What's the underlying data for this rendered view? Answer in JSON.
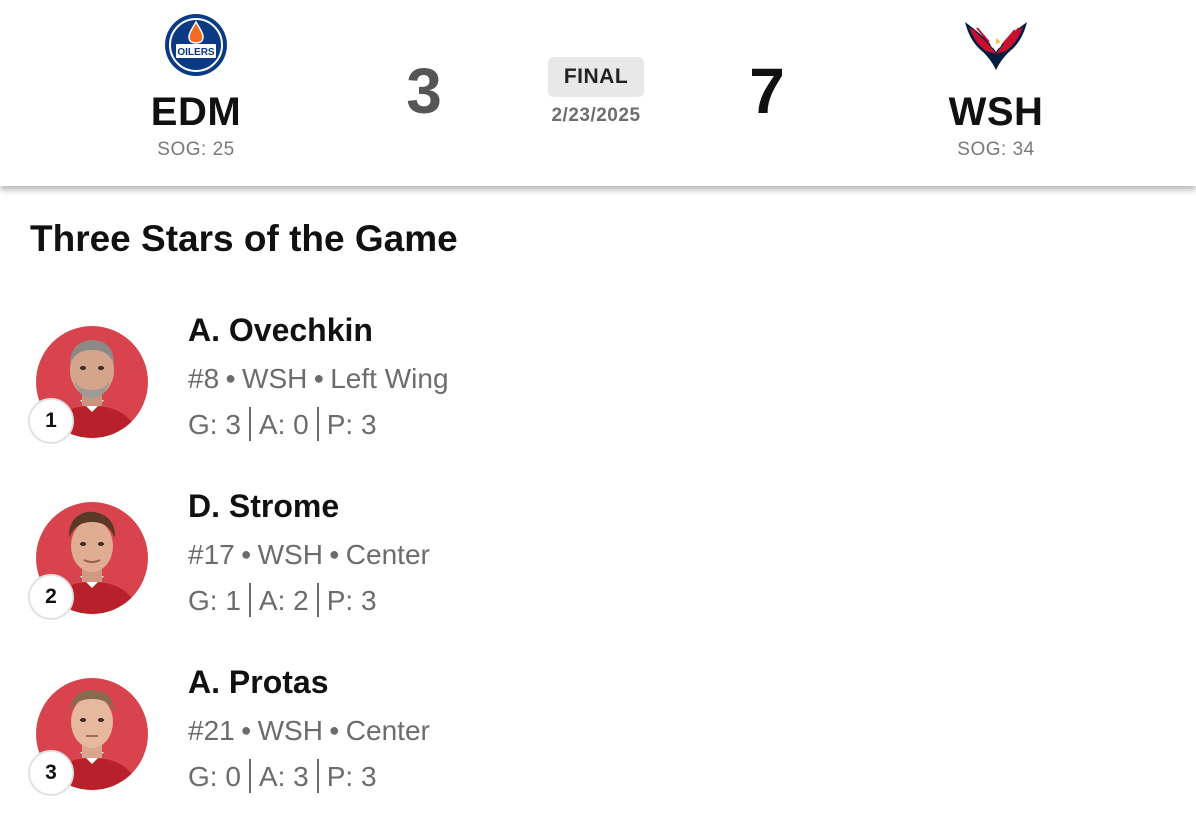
{
  "game": {
    "away": {
      "abbr": "EDM",
      "sog": "SOG: 25",
      "score": "3",
      "logo": "oilers-logo",
      "logo_text": "OILERS",
      "color": "#0a3a84"
    },
    "home": {
      "abbr": "WSH",
      "sog": "SOG: 34",
      "score": "7",
      "logo": "capitals-eagle-logo",
      "color": "#c8102e"
    },
    "status": "FINAL",
    "date": "2/23/2025"
  },
  "section_title": "Three Stars of the Game",
  "stars": [
    {
      "rank": "1",
      "name": "A. Ovechkin",
      "number": "#8",
      "team": "WSH",
      "position": "Left Wing",
      "goals": "G: 3",
      "assists": "A: 0",
      "points": "P: 3",
      "avatar": "player-headshot"
    },
    {
      "rank": "2",
      "name": "D. Strome",
      "number": "#17",
      "team": "WSH",
      "position": "Center",
      "goals": "G: 1",
      "assists": "A: 2",
      "points": "P: 3",
      "avatar": "player-headshot"
    },
    {
      "rank": "3",
      "name": "A. Protas",
      "number": "#21",
      "team": "WSH",
      "position": "Center",
      "goals": "G: 0",
      "assists": "A: 3",
      "points": "P: 3",
      "avatar": "player-headshot"
    }
  ],
  "colors": {
    "avatar_bg": "#d9434d",
    "text_primary": "#111111",
    "text_secondary": "#6c6c6c",
    "badge_bg": "#e8e8e8"
  }
}
